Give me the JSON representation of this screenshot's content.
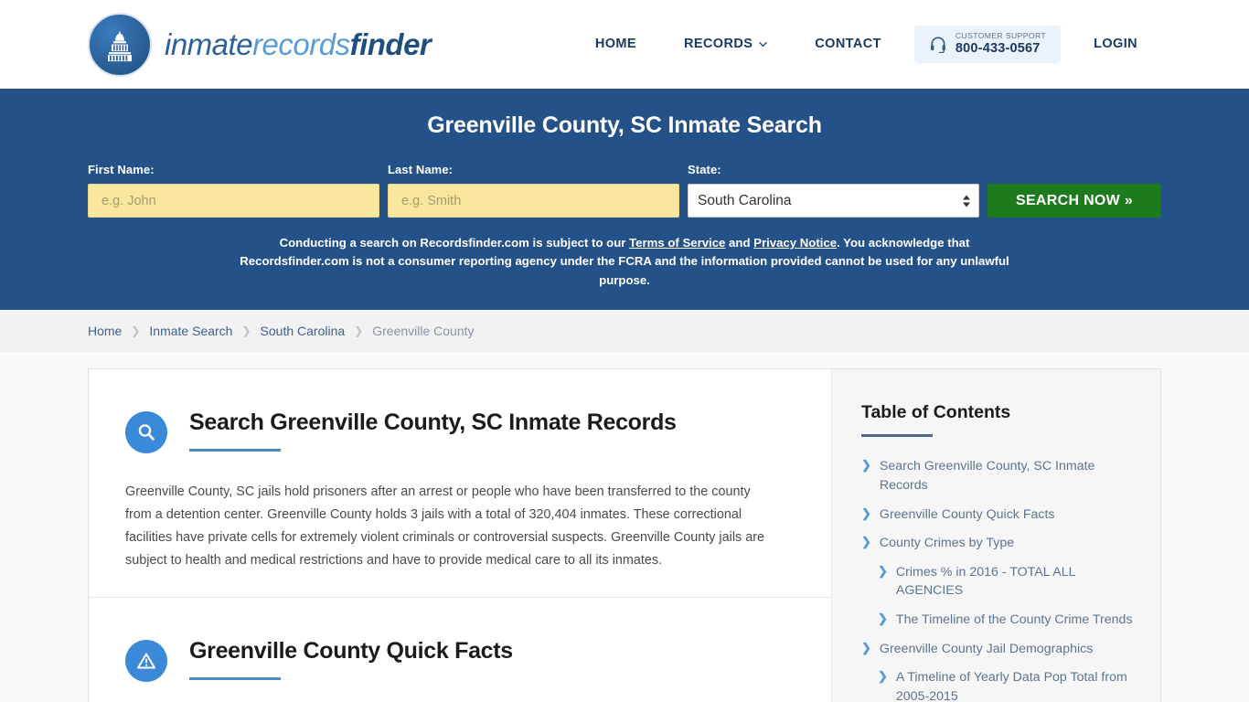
{
  "header": {
    "brand": {
      "part1": "inmate",
      "part2": "records",
      "part3": "finder"
    },
    "nav": [
      {
        "label": "HOME",
        "icon": null
      },
      {
        "label": "RECORDS",
        "icon": "chevron-down-icon"
      },
      {
        "label": "CONTACT",
        "icon": null
      }
    ],
    "support": {
      "icon": "headset-icon",
      "label": "CUSTOMER SUPPORT",
      "phone": "800-433-0567"
    },
    "login": "LOGIN"
  },
  "search": {
    "title": "Greenville County, SC Inmate Search",
    "first_name_label": "First Name:",
    "first_name_placeholder": "e.g. John",
    "first_name_value": "",
    "last_name_label": "Last Name:",
    "last_name_placeholder": "e.g. Smith",
    "last_name_value": "",
    "state_label": "State:",
    "state_value": "South Carolina",
    "button": "SEARCH NOW »",
    "disclaimer_1": "Conducting a search on Recordsfinder.com is subject to our ",
    "terms_link": "Terms of Service",
    "disclaimer_and": " and ",
    "privacy_link": "Privacy Notice",
    "disclaimer_2": ". You acknowledge that Recordsfinder.com is not a consumer reporting agency under the FCRA and the information provided cannot be used for any unlawful purpose."
  },
  "breadcrumbs": [
    {
      "label": "Home",
      "current": false
    },
    {
      "label": "Inmate Search",
      "current": false
    },
    {
      "label": "South Carolina",
      "current": false
    },
    {
      "label": "Greenville County",
      "current": true
    }
  ],
  "sections": [
    {
      "icon": "search-icon",
      "title": "Search Greenville County, SC Inmate Records",
      "body": "Greenville County, SC jails hold prisoners after an arrest or people who have been transferred to the county from a detention center. Greenville County holds 3 jails with a total of 320,404 inmates. These correctional facilities have private cells for extremely violent criminals or controversial suspects. Greenville County jails are subject to health and medical restrictions and have to provide medical care to all its inmates."
    },
    {
      "icon": "warning-icon",
      "title": "Greenville County Quick Facts",
      "body": ""
    }
  ],
  "toc": {
    "title": "Table of Contents",
    "items": [
      {
        "label": "Search Greenville County, SC Inmate Records",
        "sub": false
      },
      {
        "label": "Greenville County Quick Facts",
        "sub": false
      },
      {
        "label": "County Crimes by Type",
        "sub": false
      },
      {
        "label": "Crimes % in 2016 - TOTAL ALL AGENCIES",
        "sub": true
      },
      {
        "label": "The Timeline of the County Crime Trends",
        "sub": true
      },
      {
        "label": "Greenville County Jail Demographics",
        "sub": false
      },
      {
        "label": "A Timeline of Yearly Data Pop Total from 2005-2015",
        "sub": true
      }
    ]
  },
  "colors": {
    "brand_blue": "#255189",
    "accent_blue": "#3b8ada",
    "button_green": "#1d7a1d",
    "input_yellow": "#f9e79f"
  }
}
